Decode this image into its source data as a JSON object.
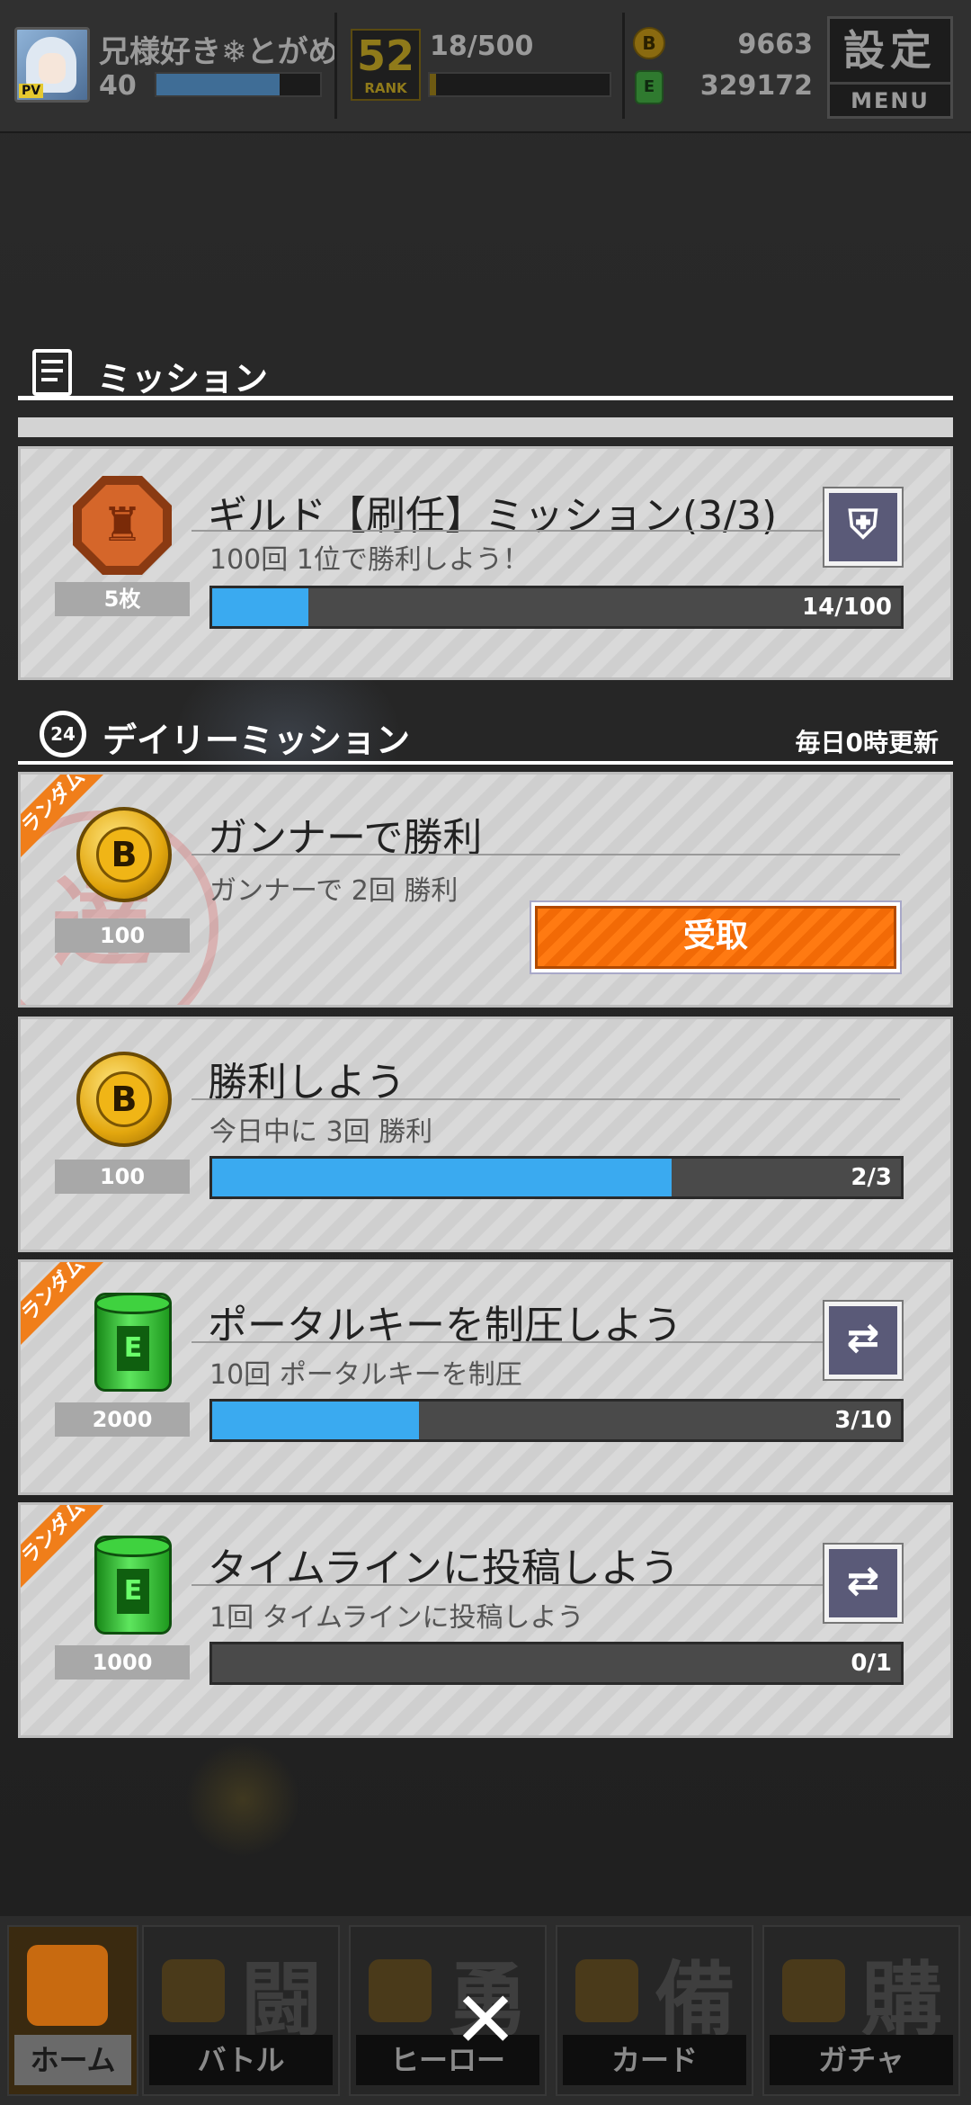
{
  "status_bar": {
    "player_name": "兄様好き❄とがめ",
    "player_level": "40",
    "exp_progress": 0.75,
    "rank_number": "52",
    "rank_label": "RANK",
    "stamina": "18/500",
    "stamina_progress": 0.036,
    "gold_currency": "9663",
    "green_currency": "329172",
    "menu_kanji": "設定",
    "menu_label": "MENU"
  },
  "mission_section": {
    "title": "ミッション"
  },
  "guild_mission": {
    "title": "ギルド【刷任】ミッション(3/3)",
    "description": "100回 1位で勝利しよう！",
    "reward_count": "5枚",
    "progress_text": "14/100",
    "progress": 0.14
  },
  "daily_section": {
    "icon_text": "24",
    "title": "デイリーミッション",
    "refresh_note": "毎日0時更新"
  },
  "daily_missions": [
    {
      "random_tag": "ランダム",
      "title": "ガンナーで勝利",
      "description": "ガンナーで 2回 勝利",
      "reward_count": "100",
      "claim_label": "受取"
    },
    {
      "title": "勝利しよう",
      "description": "今日中に 3回 勝利",
      "reward_count": "100",
      "progress_text": "2/3",
      "progress": 0.667
    },
    {
      "random_tag": "ランダム",
      "title": "ポータルキーを制圧しよう",
      "description": "10回 ポータルキーを制圧",
      "reward_count": "2000",
      "progress_text": "3/10",
      "progress": 0.3
    },
    {
      "random_tag": "ランダム",
      "title": "タイムラインに投稿しよう",
      "description": "1回 タイムラインに投稿しよう",
      "reward_count": "1000",
      "progress_text": "0/1",
      "progress": 0
    }
  ],
  "bottom_nav": [
    {
      "kanji": "",
      "label": "ホーム"
    },
    {
      "kanji": "闘",
      "label": "バトル"
    },
    {
      "kanji": "勇",
      "label": "ヒーロー"
    },
    {
      "kanji": "備",
      "label": "カード"
    },
    {
      "kanji": "購",
      "label": "ガチャ"
    }
  ],
  "close_glyph": "✕",
  "icons": {
    "guild_side": "shield-icon",
    "reroll_side": "refresh-icon",
    "gold_coin": "B",
    "green_drum": "E",
    "guild_medal": "medal-icon"
  },
  "colors": {
    "progress_fill": "#3aaaf0",
    "claim_orange": "#ff7a12",
    "random_tag": "#f07e1a"
  }
}
